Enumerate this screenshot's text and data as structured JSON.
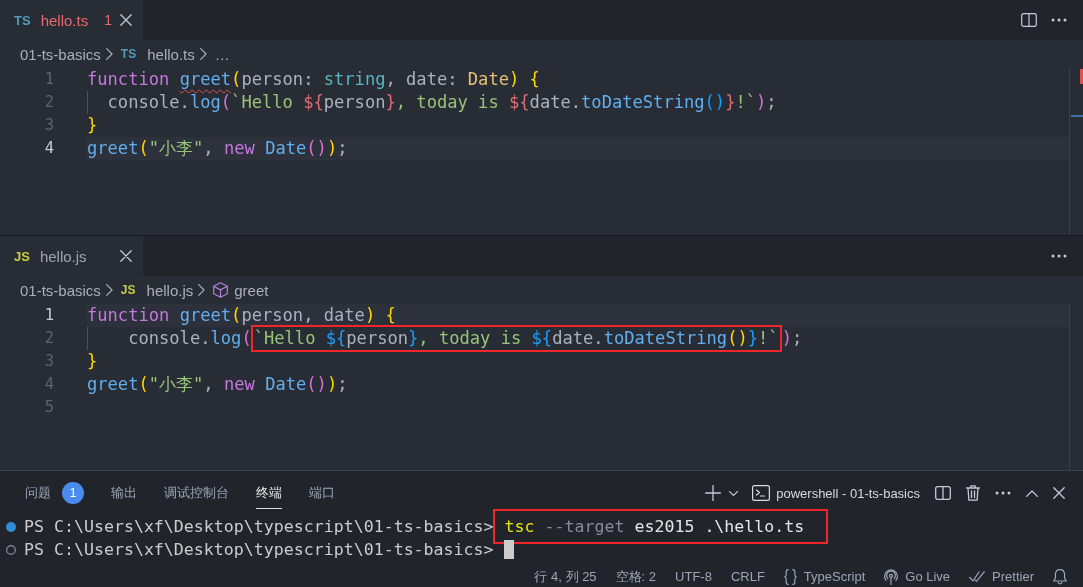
{
  "editor_groups": [
    {
      "focused": true,
      "tabs": [
        {
          "kind": "typescript",
          "file_badge": "TS",
          "label": "hello.ts",
          "problems": "1",
          "has_error": true,
          "selected": true
        }
      ],
      "actions": [
        {
          "kind": "split"
        },
        {
          "kind": "more"
        }
      ],
      "breadcrumbs": [
        {
          "kind": "folder",
          "label": "01-ts-basics"
        },
        {
          "kind": "typescript",
          "badge": "TS",
          "label": "hello.ts"
        },
        {
          "kind": "more",
          "label": "…"
        }
      ],
      "lines": [
        {
          "number": "1",
          "current": false,
          "guide": false,
          "segments": [
            {
              "boxed": false,
              "tokens": [
                {
                  "text": "function ",
                  "kind": "keyword"
                },
                {
                  "text": "greet",
                  "kind": "function",
                  "squiggle": true
                },
                {
                  "text": "(",
                  "kind": "bracket1"
                },
                {
                  "text": "person: ",
                  "kind": "plain"
                },
                {
                  "text": "string",
                  "kind": "primitive"
                },
                {
                  "text": ", date: ",
                  "kind": "plain"
                },
                {
                  "text": "Date",
                  "kind": "class"
                },
                {
                  "text": ") {",
                  "kind": "bracket1"
                }
              ]
            }
          ]
        },
        {
          "number": "2",
          "current": false,
          "guide": true,
          "segments": [
            {
              "boxed": false,
              "tokens": [
                {
                  "text": "  console.",
                  "kind": "plain"
                },
                {
                  "text": "log",
                  "kind": "function"
                },
                {
                  "text": "(",
                  "kind": "bracket2"
                },
                {
                  "text": "`Hello ",
                  "kind": "string"
                },
                {
                  "text": "${",
                  "kind": "embed"
                },
                {
                  "text": "person",
                  "kind": "plain"
                },
                {
                  "text": "}",
                  "kind": "embed"
                },
                {
                  "text": ", today is ",
                  "kind": "string"
                },
                {
                  "text": "${",
                  "kind": "embed"
                },
                {
                  "text": "date.",
                  "kind": "plain"
                },
                {
                  "text": "toDateString",
                  "kind": "function"
                },
                {
                  "text": "()",
                  "kind": "bracket3"
                },
                {
                  "text": "}",
                  "kind": "embed"
                },
                {
                  "text": "!`",
                  "kind": "string"
                },
                {
                  "text": ")",
                  "kind": "bracket2"
                },
                {
                  "text": ";",
                  "kind": "plain"
                }
              ]
            }
          ]
        },
        {
          "number": "3",
          "current": false,
          "guide": false,
          "segments": [
            {
              "boxed": false,
              "tokens": [
                {
                  "text": "}",
                  "kind": "bracket1"
                }
              ]
            }
          ]
        },
        {
          "number": "4",
          "current": true,
          "guide": false,
          "segments": [
            {
              "boxed": false,
              "tokens": [
                {
                  "text": "greet",
                  "kind": "function"
                },
                {
                  "text": "(",
                  "kind": "bracket1"
                },
                {
                  "text": "\"小李\"",
                  "kind": "string"
                },
                {
                  "text": ", ",
                  "kind": "plain"
                },
                {
                  "text": "new ",
                  "kind": "keyword"
                },
                {
                  "text": "Date",
                  "kind": "function"
                },
                {
                  "text": "()",
                  "kind": "bracket2"
                },
                {
                  "text": ")",
                  "kind": "bracket1"
                },
                {
                  "text": ";",
                  "kind": "plain"
                }
              ]
            }
          ]
        }
      ],
      "ruler_marks": [
        {
          "kind": "error"
        },
        {
          "kind": "cursor"
        }
      ]
    },
    {
      "focused": false,
      "tabs": [
        {
          "kind": "javascript",
          "file_badge": "JS",
          "label": "hello.js",
          "has_error": false,
          "selected": true
        }
      ],
      "actions": [
        {
          "kind": "more"
        }
      ],
      "breadcrumbs": [
        {
          "kind": "folder",
          "label": "01-ts-basics"
        },
        {
          "kind": "javascript",
          "badge": "JS",
          "label": "hello.js"
        },
        {
          "kind": "symbol",
          "label": "greet"
        }
      ],
      "lines": [
        {
          "number": "1",
          "current": true,
          "guide": false,
          "segments": [
            {
              "boxed": false,
              "tokens": [
                {
                  "text": "function ",
                  "kind": "keyword"
                },
                {
                  "text": "greet",
                  "kind": "function"
                },
                {
                  "text": "(",
                  "kind": "bracket1"
                },
                {
                  "text": "person, date",
                  "kind": "plain"
                },
                {
                  "text": ") {",
                  "kind": "bracket1"
                }
              ]
            }
          ]
        },
        {
          "number": "2",
          "current": false,
          "guide": true,
          "segments": [
            {
              "boxed": false,
              "tokens": [
                {
                  "text": "    console.",
                  "kind": "plain"
                },
                {
                  "text": "log",
                  "kind": "function"
                },
                {
                  "text": "(",
                  "kind": "bracket2"
                }
              ]
            },
            {
              "boxed": true,
              "tokens": [
                {
                  "text": "`Hello ",
                  "kind": "string"
                },
                {
                  "text": "${",
                  "kind": "bracket3"
                },
                {
                  "text": "person",
                  "kind": "plain"
                },
                {
                  "text": "}",
                  "kind": "bracket3"
                },
                {
                  "text": ", today is ",
                  "kind": "string"
                },
                {
                  "text": "${",
                  "kind": "bracket3"
                },
                {
                  "text": "date.",
                  "kind": "plain"
                },
                {
                  "text": "toDateString",
                  "kind": "function"
                },
                {
                  "text": "()",
                  "kind": "bracket1"
                },
                {
                  "text": "}",
                  "kind": "bracket3"
                },
                {
                  "text": "!`",
                  "kind": "string"
                }
              ]
            },
            {
              "boxed": false,
              "tokens": [
                {
                  "text": ")",
                  "kind": "bracket2"
                },
                {
                  "text": ";",
                  "kind": "plain"
                }
              ]
            }
          ]
        },
        {
          "number": "3",
          "current": false,
          "guide": false,
          "segments": [
            {
              "boxed": false,
              "tokens": [
                {
                  "text": "}",
                  "kind": "bracket1"
                }
              ]
            }
          ]
        },
        {
          "number": "4",
          "current": false,
          "guide": false,
          "segments": [
            {
              "boxed": false,
              "tokens": [
                {
                  "text": "greet",
                  "kind": "function"
                },
                {
                  "text": "(",
                  "kind": "bracket1"
                },
                {
                  "text": "\"小李\"",
                  "kind": "string"
                },
                {
                  "text": ", ",
                  "kind": "plain"
                },
                {
                  "text": "new ",
                  "kind": "keyword"
                },
                {
                  "text": "Date",
                  "kind": "function"
                },
                {
                  "text": "()",
                  "kind": "bracket2"
                },
                {
                  "text": ")",
                  "kind": "bracket1"
                },
                {
                  "text": ";",
                  "kind": "plain"
                }
              ]
            }
          ]
        },
        {
          "number": "5",
          "current": false
        }
      ]
    }
  ],
  "panel": {
    "tabs": [
      {
        "label": "问题",
        "badge": "1",
        "selected": false
      },
      {
        "label": "输出",
        "selected": false
      },
      {
        "label": "调试控制台",
        "selected": false
      },
      {
        "label": "终端",
        "selected": true
      },
      {
        "label": "端口",
        "selected": false
      }
    ],
    "actions_left": [
      {
        "kind": "plus"
      },
      {
        "kind": "dropdown"
      }
    ],
    "terminal": {
      "label": "powershell - 01-ts-basics",
      "lines": [
        {
          "completed": true,
          "prompt": "PS C:\\Users\\xf\\Desktop\\typescript\\01-ts-basics>",
          "command": [
            {
              "text": "tsc",
              "kind": "command"
            },
            {
              "text": " --target",
              "kind": "flag"
            },
            {
              "text": " es2015 .\\hello.ts",
              "kind": "argument"
            }
          ],
          "boxed": true,
          "cursor": false
        },
        {
          "completed": false,
          "prompt": "PS C:\\Users\\xf\\Desktop\\typescript\\01-ts-basics>",
          "cursor": true
        }
      ]
    },
    "actions_right": [
      {
        "kind": "split"
      },
      {
        "kind": "trash"
      },
      {
        "kind": "more"
      },
      {
        "kind": "maximize"
      },
      {
        "kind": "close"
      }
    ]
  },
  "status_bar": {
    "items": [
      {
        "kind": "text",
        "label": "行 4, 列 25"
      },
      {
        "kind": "text",
        "label": "空格: 2"
      },
      {
        "kind": "text",
        "label": "UTF-8"
      },
      {
        "kind": "text",
        "label": "CRLF"
      },
      {
        "kind": "language",
        "label": "TypeScript"
      },
      {
        "kind": "live",
        "label": "Go Live"
      },
      {
        "kind": "formatter",
        "label": "Prettier"
      },
      {
        "kind": "notifications"
      }
    ]
  }
}
